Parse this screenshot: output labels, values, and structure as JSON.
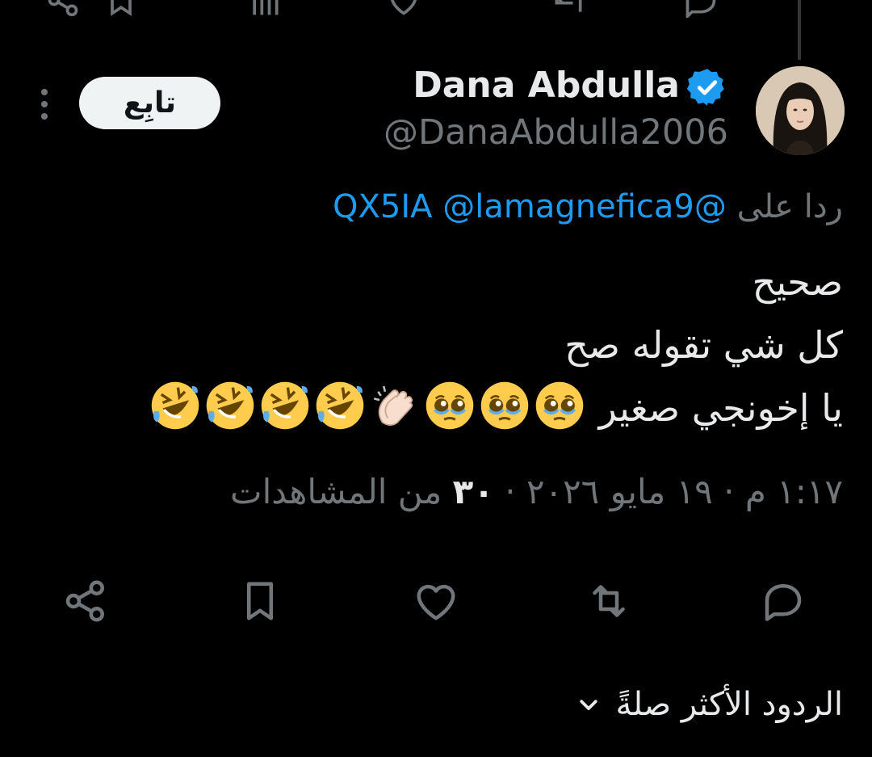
{
  "author": {
    "name": "Dana Abdulla",
    "handle": "@DanaAbdulla2006",
    "verified": true,
    "avatar_icon": "profile-photo"
  },
  "follow_button": {
    "label": "تابِع"
  },
  "more_icon": "more-vertical-icon",
  "reply_to": {
    "prefix": "ردا على",
    "mentions": [
      "@QX5IA",
      "@lamagnefica9"
    ]
  },
  "tweet": {
    "lines": [
      "صحيح",
      "كل شي تقوله صح",
      "يا إخونجي صغير"
    ],
    "emojis": [
      "pleading-face",
      "pleading-face",
      "pleading-face",
      "clapping-hands",
      "rolling-on-floor-laughing",
      "rolling-on-floor-laughing",
      "rolling-on-floor-laughing",
      "rolling-on-floor-laughing"
    ]
  },
  "meta": {
    "time": "١:١٧ م",
    "separator": "·",
    "date": "١٩ مايو ٢٠٢٦",
    "views_count": "٣٠",
    "views_label": "من المشاهدات"
  },
  "actions": [
    "reply-icon",
    "retweet-icon",
    "like-icon",
    "bookmark-icon",
    "share-icon"
  ],
  "sort": {
    "label": "الردود الأكثر صلةً",
    "icon": "chevron-down-icon"
  },
  "colors": {
    "background": "#000000",
    "text": "#e7e9ea",
    "secondary": "#71767b",
    "accent": "#1d9bf0",
    "button_bg": "#eff3f4"
  }
}
